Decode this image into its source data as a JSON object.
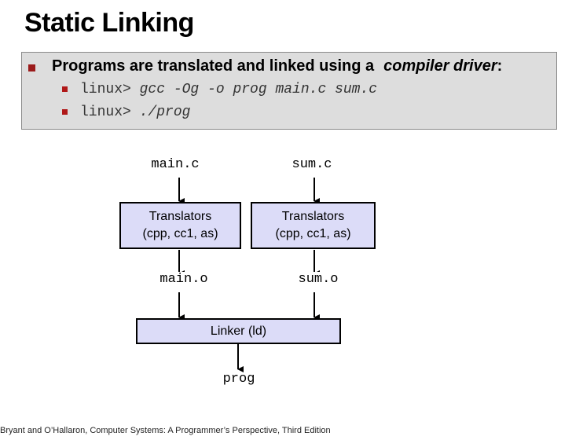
{
  "title": "Static Linking",
  "bullet": {
    "text": "Programs are translated and linked using a",
    "emphasis": "compiler driver",
    "suffix": ":"
  },
  "commands": [
    {
      "prompt": "linux>",
      "command": "gcc -Og -o prog main.c sum.c"
    },
    {
      "prompt": "linux>",
      "command": "./prog"
    }
  ],
  "diagram": {
    "sources": [
      "main.c",
      "sum.c"
    ],
    "translators": [
      {
        "line1": "Translators",
        "line2": "(cpp, cc1, as)"
      },
      {
        "line1": "Translators",
        "line2": "(cpp, cc1, as)"
      }
    ],
    "objects": [
      "main.o",
      "sum.o"
    ],
    "linker": "Linker (ld)",
    "output": "prog"
  },
  "footer": "Bryant and O’Hallaron, Computer Systems: A Programmer’s Perspective, Third Edition",
  "colors": {
    "bullet": "#9b1b1b",
    "box_background": "#dddddd",
    "node_fill": "#dcdcf8"
  }
}
